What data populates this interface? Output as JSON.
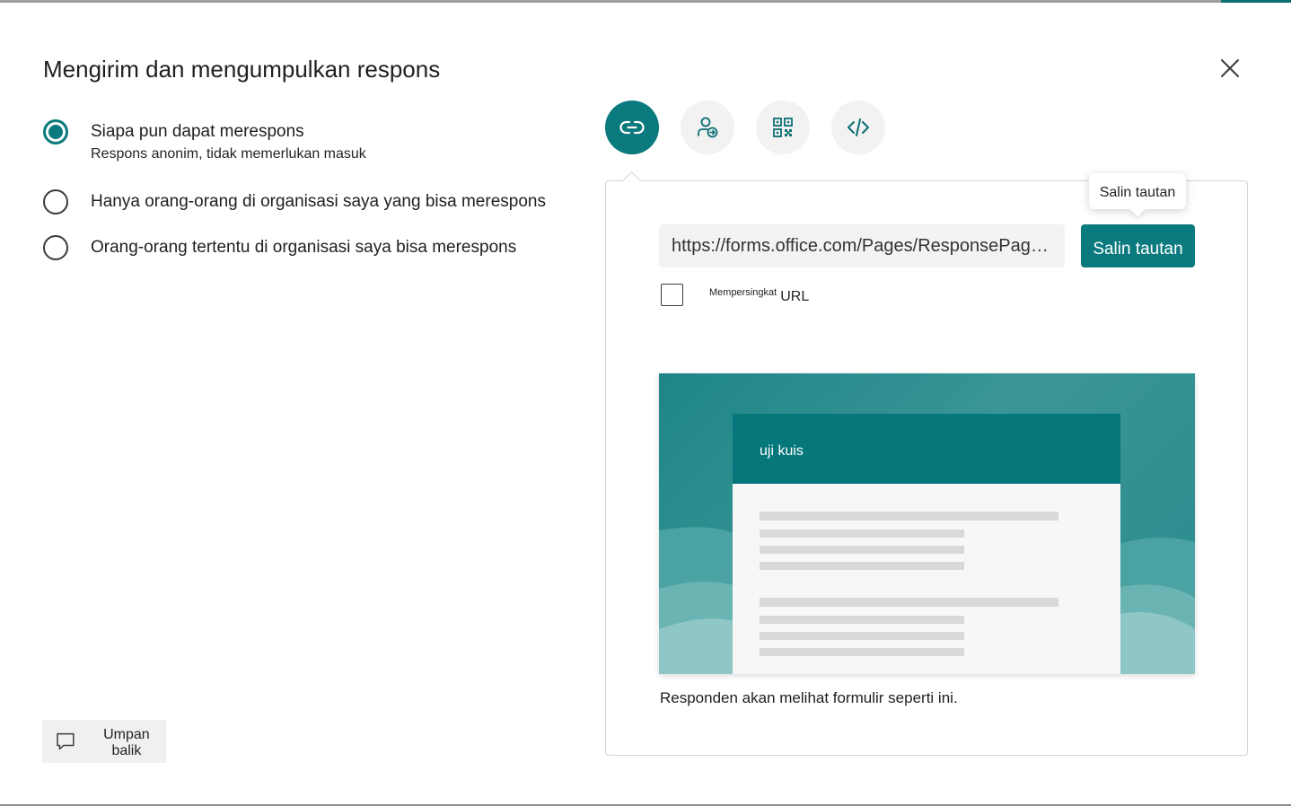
{
  "dialog": {
    "title": "Mengirim dan mengumpulkan respons",
    "close_icon": "close-icon"
  },
  "response_options": [
    {
      "label": "Siapa pun dapat merespons",
      "sublabel": "Respons anonim, tidak memerlukan masuk",
      "selected": true
    },
    {
      "label": "Hanya orang-orang di organisasi saya yang bisa merespons",
      "selected": false
    },
    {
      "label": "Orang-orang tertentu di organisasi saya bisa merespons",
      "selected": false
    }
  ],
  "share_tabs": [
    {
      "icon": "link-icon",
      "active": true
    },
    {
      "icon": "invite-person-icon",
      "active": false
    },
    {
      "icon": "qr-code-icon",
      "active": false
    },
    {
      "icon": "embed-code-icon",
      "active": false
    }
  ],
  "link_panel": {
    "url": "https://forms.office.com/Pages/ResponsePage.aspx",
    "copy_button_label": "Salin tautan",
    "tooltip": "Salin tautan",
    "shorten_small": "Mempersingkat",
    "shorten_url": "URL",
    "shorten_checked": false
  },
  "preview": {
    "form_title": "uji kuis",
    "caption": "Responden akan melihat formulir seperti ini."
  },
  "feedback": {
    "label": "Umpan balik",
    "icon": "feedback-comment-icon"
  },
  "colors": {
    "accent": "#0b7a7e",
    "preview_header": "#06777b",
    "tab_inactive": "#f2f2f2"
  }
}
